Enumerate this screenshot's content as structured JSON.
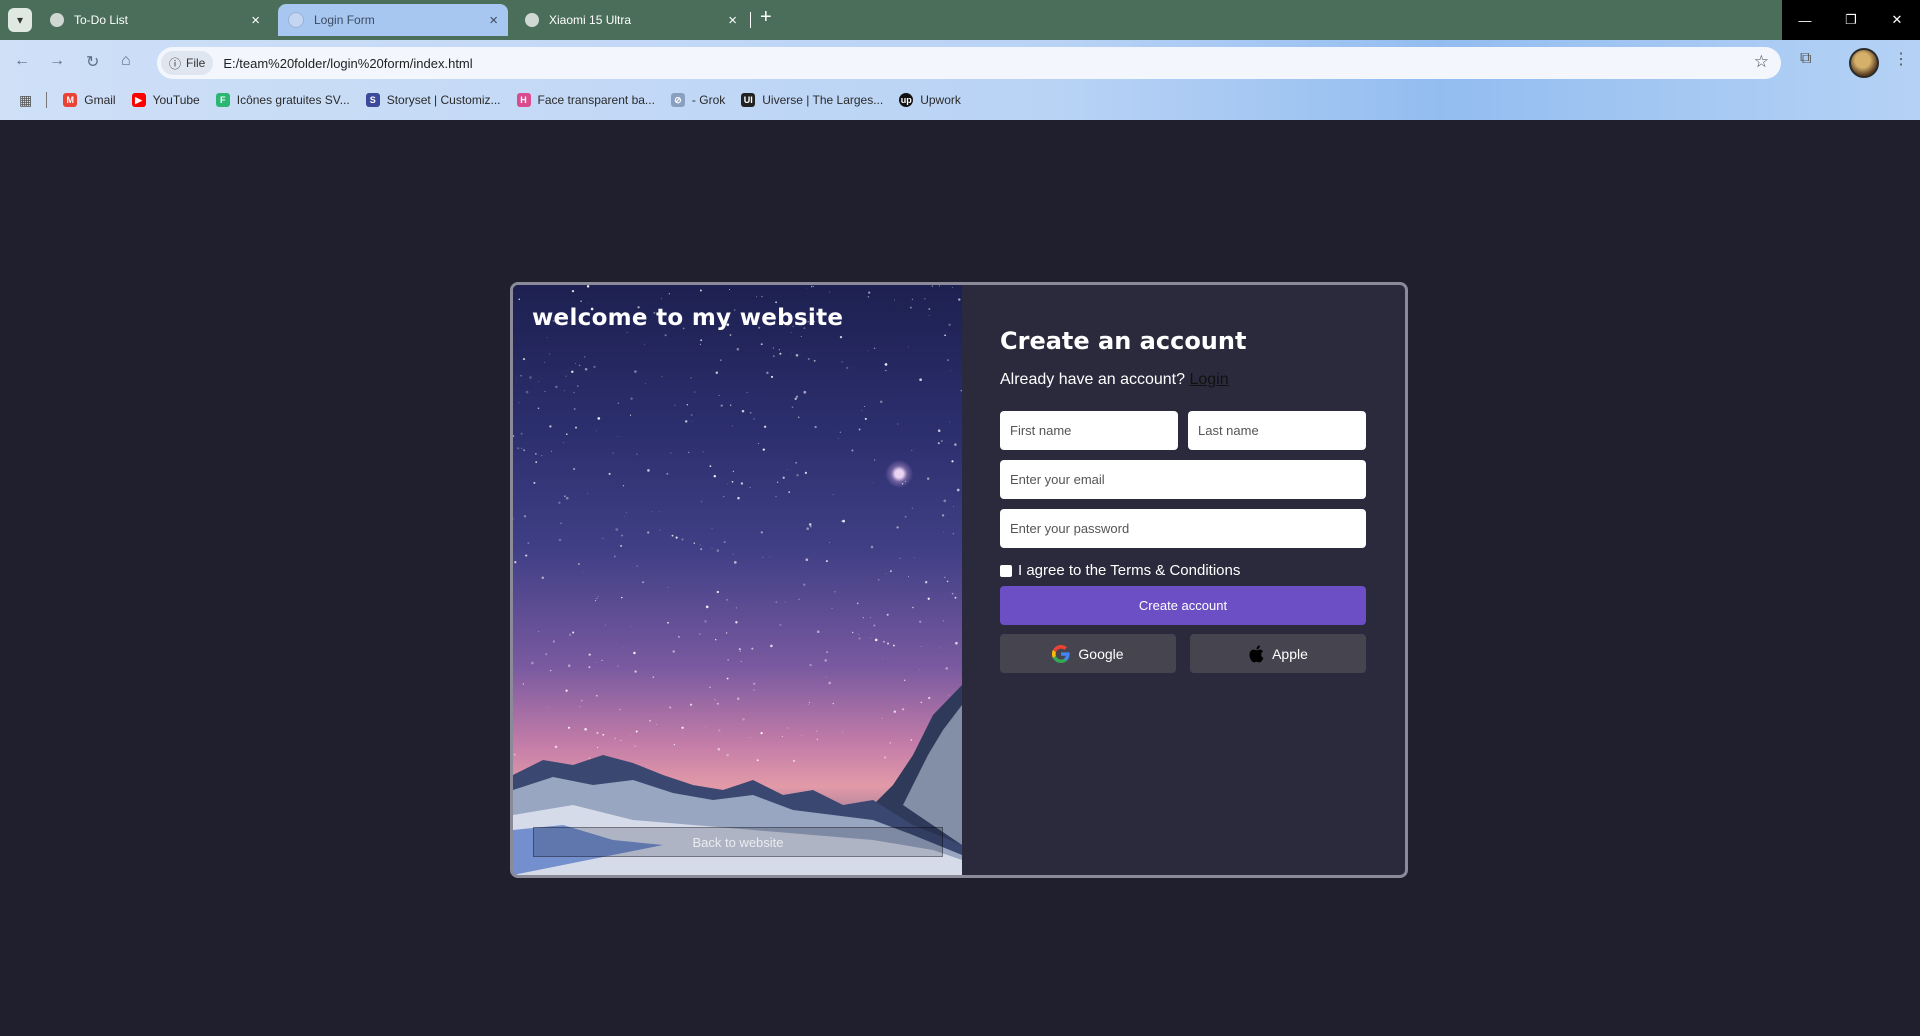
{
  "browser": {
    "tabs": [
      {
        "title": "To-Do List"
      },
      {
        "title": "Login Form"
      },
      {
        "title": "Xiaomi 15 Ultra"
      }
    ],
    "new_tab": "+",
    "address": {
      "scheme_chip": "File",
      "url": "E:/team%20folder/login%20form/index.html"
    },
    "bookmarks": [
      {
        "label": "Gmail",
        "icon": "gmail-icon"
      },
      {
        "label": "YouTube",
        "icon": "youtube-icon"
      },
      {
        "label": "Icônes gratuites SV...",
        "icon": "flaticon-icon"
      },
      {
        "label": "Storyset | Customiz...",
        "icon": "storyset-icon"
      },
      {
        "label": "Face transparent ba...",
        "icon": "face-icon"
      },
      {
        "label": "- Grok",
        "icon": "grok-icon"
      },
      {
        "label": "Uiverse | The Larges...",
        "icon": "uiverse-icon"
      },
      {
        "label": "Upwork",
        "icon": "upwork-icon"
      }
    ]
  },
  "page": {
    "hero": {
      "title": "welcome to my website",
      "back_button": "Back to website"
    },
    "form": {
      "title": "Create an account",
      "have_account": "Already have an account?",
      "login_link": "Login",
      "first_name_placeholder": "First name",
      "last_name_placeholder": "Last name",
      "email_placeholder": "Enter your email",
      "password_placeholder": "Enter your password",
      "terms_label": "I agree to the Terms & Conditions",
      "terms_checked": false,
      "create_button": "Create account",
      "google_button": "Google",
      "apple_button": "Apple"
    }
  },
  "colors": {
    "page_background": "#1f1f2e",
    "card_background": "#2b2a3c",
    "primary_button": "#6c4fc4",
    "social_button": "#45444f"
  }
}
